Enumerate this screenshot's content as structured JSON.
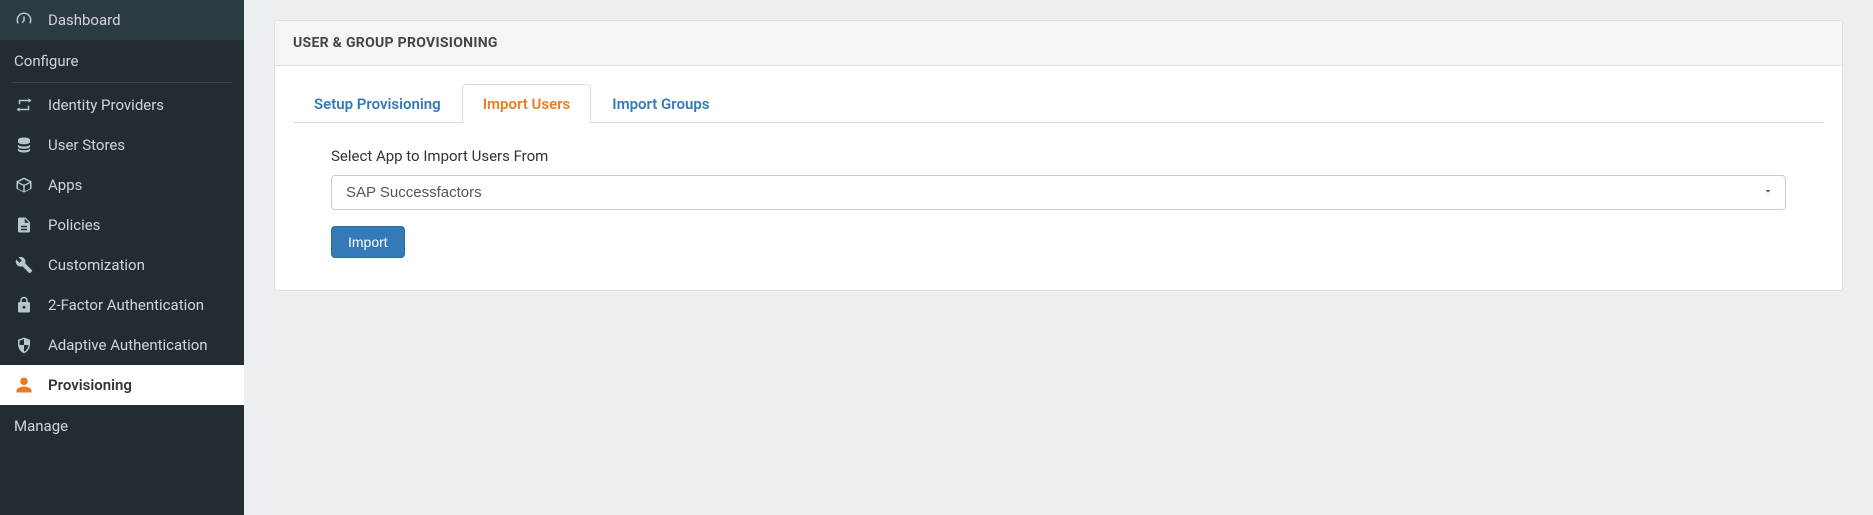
{
  "sidebar": {
    "items": [
      {
        "label": "Dashboard"
      },
      {
        "label": "Identity Providers"
      },
      {
        "label": "User Stores"
      },
      {
        "label": "Apps"
      },
      {
        "label": "Policies"
      },
      {
        "label": "Customization"
      },
      {
        "label": "2-Factor Authentication"
      },
      {
        "label": "Adaptive Authentication"
      },
      {
        "label": "Provisioning"
      }
    ],
    "headers": {
      "configure": "Configure",
      "manage": "Manage"
    }
  },
  "panel": {
    "title": "USER & GROUP PROVISIONING"
  },
  "tabs": [
    {
      "label": "Setup Provisioning"
    },
    {
      "label": "Import Users"
    },
    {
      "label": "Import Groups"
    }
  ],
  "form": {
    "label": "Select App to Import Users From",
    "selected": "SAP Successfactors",
    "button": "Import"
  }
}
